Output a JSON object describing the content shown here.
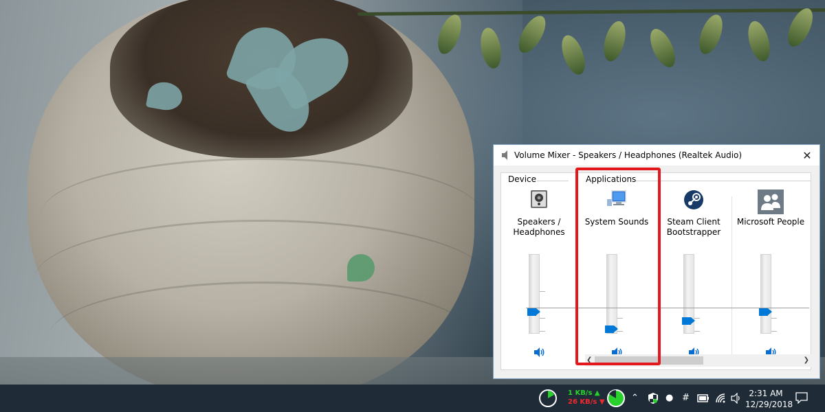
{
  "window": {
    "title": "Volume Mixer - Speakers / Headphones (Realtek Audio)",
    "close_glyph": "✕"
  },
  "groups": {
    "device_label": "Device",
    "applications_label": "Applications"
  },
  "channels": [
    {
      "name_line1": "Speakers /",
      "name_line2": "Headphones",
      "icon": "speaker-device-icon",
      "volume_fraction": 0.24
    },
    {
      "name_line1": "System Sounds",
      "name_line2": "",
      "icon": "system-sounds-icon",
      "volume_fraction": 0.0
    },
    {
      "name_line1": "Steam Client",
      "name_line2": "Bootstrapper",
      "icon": "steam-icon",
      "volume_fraction": 0.12
    },
    {
      "name_line1": "Microsoft People",
      "name_line2": "",
      "icon": "people-icon",
      "volume_fraction": 0.24
    }
  ],
  "taskbar": {
    "net_upload": "1 KB/s ▲",
    "net_download": "26 KB/s ▼",
    "time": "2:31 AM",
    "date": "12/29/2018"
  },
  "colors": {
    "accent": "#0078d7",
    "highlight": "#e3181d",
    "taskbar": "#1f2c38",
    "net_up": "#29d12c",
    "net_down": "#f2272d"
  }
}
